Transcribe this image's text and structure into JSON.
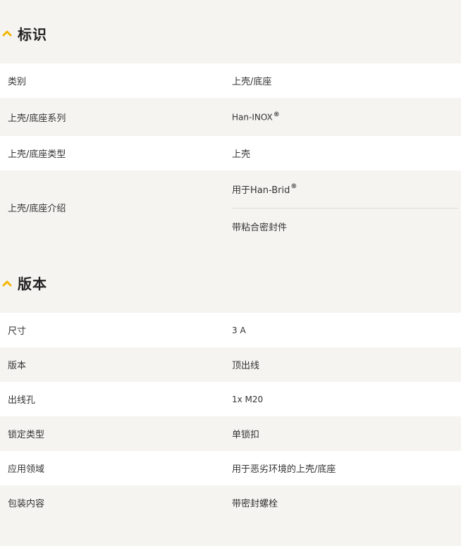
{
  "colors": {
    "accent": "#f2b705",
    "row_white": "#ffffff",
    "row_grey": "#f5f4f1",
    "divider": "#dcdcdc"
  },
  "sections": {
    "identification": {
      "title": "标识",
      "icon": "chevron-up-icon",
      "rows": {
        "category": {
          "label": "类别",
          "value": "上壳/底座"
        },
        "series": {
          "label": "上壳/底座系列",
          "value": "Han-INOX",
          "sup": "®"
        },
        "type": {
          "label": "上壳/底座类型",
          "value": "上壳"
        },
        "intro": {
          "label": "上壳/底座介绍",
          "value1": "用于Han-Brid",
          "value1_sup": "®",
          "value2": "带粘合密封件"
        }
      }
    },
    "version": {
      "title": "版本",
      "icon": "chevron-up-icon",
      "rows": {
        "size": {
          "label": "尺寸",
          "value": "3 A"
        },
        "version": {
          "label": "版本",
          "value": "顶出线"
        },
        "cable_entry": {
          "label": "出线孔",
          "value": "1x M20"
        },
        "locking_type": {
          "label": "锁定类型",
          "value": "单锁扣"
        },
        "application": {
          "label": "应用领域",
          "value": "用于恶劣环境的上壳/底座"
        },
        "package": {
          "label": "包装内容",
          "value": "带密封螺栓"
        }
      }
    }
  }
}
